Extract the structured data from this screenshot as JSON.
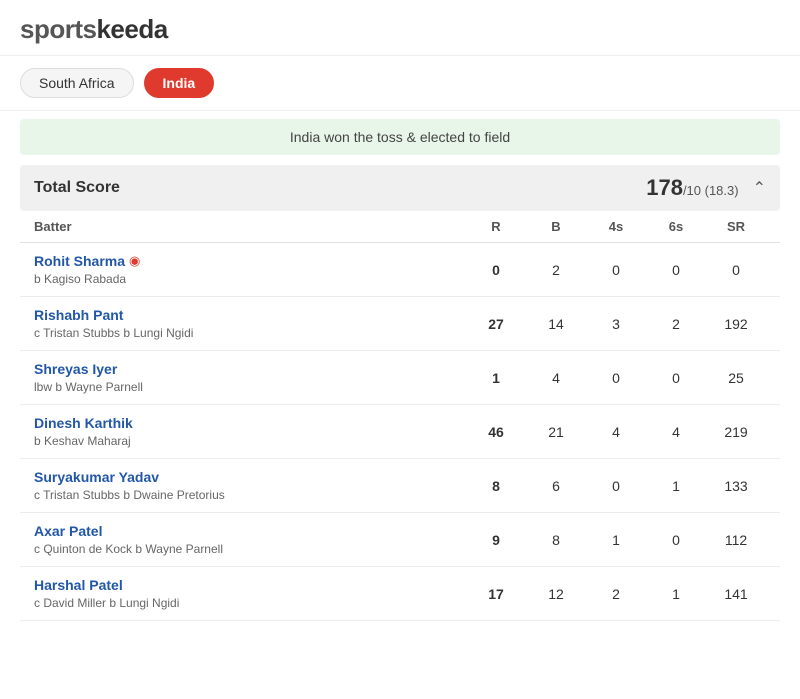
{
  "logo": {
    "part1": "sports",
    "part2": "keeda"
  },
  "teams": [
    {
      "label": "South Africa",
      "active": false
    },
    {
      "label": "India",
      "active": true
    }
  ],
  "toss": "India won the toss & elected to field",
  "scorecard": {
    "total_label": "Total Score",
    "total_score": "178",
    "total_detail": "/10 (18.3)",
    "columns": [
      "Batter",
      "R",
      "B",
      "4s",
      "6s",
      "SR"
    ],
    "batters": [
      {
        "name": "Rohit Sharma",
        "wicket_icon": true,
        "dismissal": "b Kagiso Rabada",
        "R": "0",
        "B": "2",
        "4s": "0",
        "6s": "0",
        "SR": "0",
        "r_bold": true
      },
      {
        "name": "Rishabh Pant",
        "wicket_icon": false,
        "dismissal": "c Tristan Stubbs b Lungi Ngidi",
        "R": "27",
        "B": "14",
        "4s": "3",
        "6s": "2",
        "SR": "192",
        "r_bold": true
      },
      {
        "name": "Shreyas Iyer",
        "wicket_icon": false,
        "dismissal": "lbw b Wayne Parnell",
        "R": "1",
        "B": "4",
        "4s": "0",
        "6s": "0",
        "SR": "25",
        "r_bold": true
      },
      {
        "name": "Dinesh Karthik",
        "wicket_icon": false,
        "dismissal": "b Keshav Maharaj",
        "R": "46",
        "B": "21",
        "4s": "4",
        "6s": "4",
        "SR": "219",
        "r_bold": true
      },
      {
        "name": "Suryakumar Yadav",
        "wicket_icon": false,
        "dismissal": "c Tristan Stubbs b Dwaine Pretorius",
        "R": "8",
        "B": "6",
        "4s": "0",
        "6s": "1",
        "SR": "133",
        "r_bold": true
      },
      {
        "name": "Axar Patel",
        "wicket_icon": false,
        "dismissal": "c Quinton de Kock b Wayne Parnell",
        "R": "9",
        "B": "8",
        "4s": "1",
        "6s": "0",
        "SR": "112",
        "r_bold": true
      },
      {
        "name": "Harshal Patel",
        "wicket_icon": false,
        "dismissal": "c David Miller b Lungi Ngidi",
        "R": "17",
        "B": "12",
        "4s": "2",
        "6s": "1",
        "SR": "141",
        "r_bold": true
      }
    ]
  }
}
